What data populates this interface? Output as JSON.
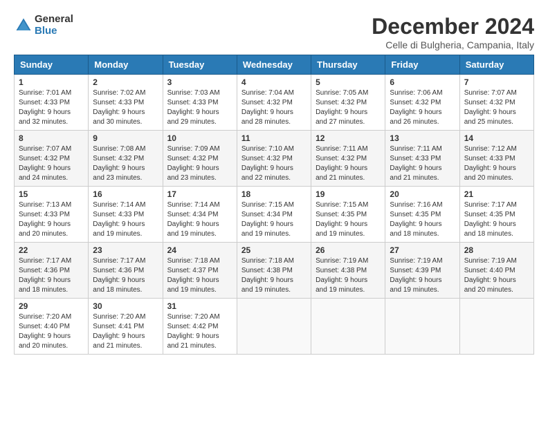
{
  "header": {
    "logo_general": "General",
    "logo_blue": "Blue",
    "month_title": "December 2024",
    "location": "Celle di Bulgheria, Campania, Italy"
  },
  "days_of_week": [
    "Sunday",
    "Monday",
    "Tuesday",
    "Wednesday",
    "Thursday",
    "Friday",
    "Saturday"
  ],
  "weeks": [
    [
      {
        "day": "1",
        "sunrise": "7:01 AM",
        "sunset": "4:33 PM",
        "daylight": "9 hours and 32 minutes."
      },
      {
        "day": "2",
        "sunrise": "7:02 AM",
        "sunset": "4:33 PM",
        "daylight": "9 hours and 30 minutes."
      },
      {
        "day": "3",
        "sunrise": "7:03 AM",
        "sunset": "4:33 PM",
        "daylight": "9 hours and 29 minutes."
      },
      {
        "day": "4",
        "sunrise": "7:04 AM",
        "sunset": "4:32 PM",
        "daylight": "9 hours and 28 minutes."
      },
      {
        "day": "5",
        "sunrise": "7:05 AM",
        "sunset": "4:32 PM",
        "daylight": "9 hours and 27 minutes."
      },
      {
        "day": "6",
        "sunrise": "7:06 AM",
        "sunset": "4:32 PM",
        "daylight": "9 hours and 26 minutes."
      },
      {
        "day": "7",
        "sunrise": "7:07 AM",
        "sunset": "4:32 PM",
        "daylight": "9 hours and 25 minutes."
      }
    ],
    [
      {
        "day": "8",
        "sunrise": "7:07 AM",
        "sunset": "4:32 PM",
        "daylight": "9 hours and 24 minutes."
      },
      {
        "day": "9",
        "sunrise": "7:08 AM",
        "sunset": "4:32 PM",
        "daylight": "9 hours and 23 minutes."
      },
      {
        "day": "10",
        "sunrise": "7:09 AM",
        "sunset": "4:32 PM",
        "daylight": "9 hours and 23 minutes."
      },
      {
        "day": "11",
        "sunrise": "7:10 AM",
        "sunset": "4:32 PM",
        "daylight": "9 hours and 22 minutes."
      },
      {
        "day": "12",
        "sunrise": "7:11 AM",
        "sunset": "4:32 PM",
        "daylight": "9 hours and 21 minutes."
      },
      {
        "day": "13",
        "sunrise": "7:11 AM",
        "sunset": "4:33 PM",
        "daylight": "9 hours and 21 minutes."
      },
      {
        "day": "14",
        "sunrise": "7:12 AM",
        "sunset": "4:33 PM",
        "daylight": "9 hours and 20 minutes."
      }
    ],
    [
      {
        "day": "15",
        "sunrise": "7:13 AM",
        "sunset": "4:33 PM",
        "daylight": "9 hours and 20 minutes."
      },
      {
        "day": "16",
        "sunrise": "7:14 AM",
        "sunset": "4:33 PM",
        "daylight": "9 hours and 19 minutes."
      },
      {
        "day": "17",
        "sunrise": "7:14 AM",
        "sunset": "4:34 PM",
        "daylight": "9 hours and 19 minutes."
      },
      {
        "day": "18",
        "sunrise": "7:15 AM",
        "sunset": "4:34 PM",
        "daylight": "9 hours and 19 minutes."
      },
      {
        "day": "19",
        "sunrise": "7:15 AM",
        "sunset": "4:35 PM",
        "daylight": "9 hours and 19 minutes."
      },
      {
        "day": "20",
        "sunrise": "7:16 AM",
        "sunset": "4:35 PM",
        "daylight": "9 hours and 18 minutes."
      },
      {
        "day": "21",
        "sunrise": "7:17 AM",
        "sunset": "4:35 PM",
        "daylight": "9 hours and 18 minutes."
      }
    ],
    [
      {
        "day": "22",
        "sunrise": "7:17 AM",
        "sunset": "4:36 PM",
        "daylight": "9 hours and 18 minutes."
      },
      {
        "day": "23",
        "sunrise": "7:17 AM",
        "sunset": "4:36 PM",
        "daylight": "9 hours and 18 minutes."
      },
      {
        "day": "24",
        "sunrise": "7:18 AM",
        "sunset": "4:37 PM",
        "daylight": "9 hours and 19 minutes."
      },
      {
        "day": "25",
        "sunrise": "7:18 AM",
        "sunset": "4:38 PM",
        "daylight": "9 hours and 19 minutes."
      },
      {
        "day": "26",
        "sunrise": "7:19 AM",
        "sunset": "4:38 PM",
        "daylight": "9 hours and 19 minutes."
      },
      {
        "day": "27",
        "sunrise": "7:19 AM",
        "sunset": "4:39 PM",
        "daylight": "9 hours and 19 minutes."
      },
      {
        "day": "28",
        "sunrise": "7:19 AM",
        "sunset": "4:40 PM",
        "daylight": "9 hours and 20 minutes."
      }
    ],
    [
      {
        "day": "29",
        "sunrise": "7:20 AM",
        "sunset": "4:40 PM",
        "daylight": "9 hours and 20 minutes."
      },
      {
        "day": "30",
        "sunrise": "7:20 AM",
        "sunset": "4:41 PM",
        "daylight": "9 hours and 21 minutes."
      },
      {
        "day": "31",
        "sunrise": "7:20 AM",
        "sunset": "4:42 PM",
        "daylight": "9 hours and 21 minutes."
      },
      null,
      null,
      null,
      null
    ]
  ]
}
